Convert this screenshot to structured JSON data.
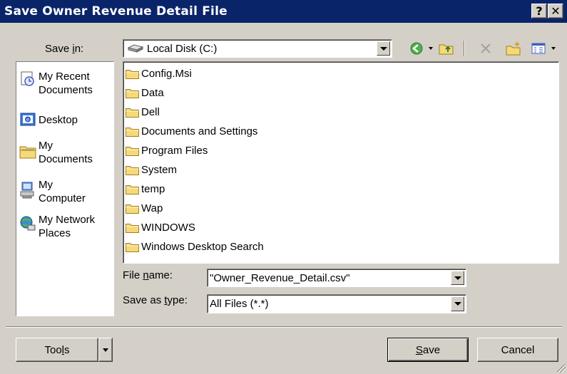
{
  "window": {
    "title": "Save Owner Revenue Detail File",
    "help_label": "?",
    "close_label": "✕"
  },
  "save_in": {
    "label_pre": "Save ",
    "label_key": "i",
    "label_post": "n:",
    "value": "Local Disk (C:)"
  },
  "toolbar": {
    "icons": [
      "back-icon",
      "up-folder-icon",
      "delete-icon",
      "new-folder-icon",
      "views-icon"
    ]
  },
  "places": [
    {
      "label": "My Recent\nDocuments",
      "icon": "recent-documents-icon"
    },
    {
      "label": "Desktop",
      "icon": "desktop-icon"
    },
    {
      "label": "My\nDocuments",
      "icon": "my-documents-icon"
    },
    {
      "label": "My\nComputer",
      "icon": "my-computer-icon"
    },
    {
      "label": "My Network\nPlaces",
      "icon": "network-places-icon"
    }
  ],
  "files": [
    "Config.Msi",
    "Data",
    "Dell",
    "Documents and Settings",
    "Program Files",
    "System",
    "temp",
    "Wap",
    "WINDOWS",
    "Windows Desktop Search"
  ],
  "file_name": {
    "label_pre": "File ",
    "label_key": "n",
    "label_post": "ame:",
    "value": "\"Owner_Revenue_Detail.csv\""
  },
  "save_as_type": {
    "label_pre": "Save as ",
    "label_key": "t",
    "label_post": "ype:",
    "value": "All Files (*.*)"
  },
  "buttons": {
    "tools_pre": "Too",
    "tools_key": "l",
    "tools_post": "s",
    "save_key": "S",
    "save_post": "ave",
    "cancel": "Cancel"
  },
  "colors": {
    "titlebar": "#0a246a",
    "face": "#d4d0c8",
    "folder": "#f5d97a"
  }
}
